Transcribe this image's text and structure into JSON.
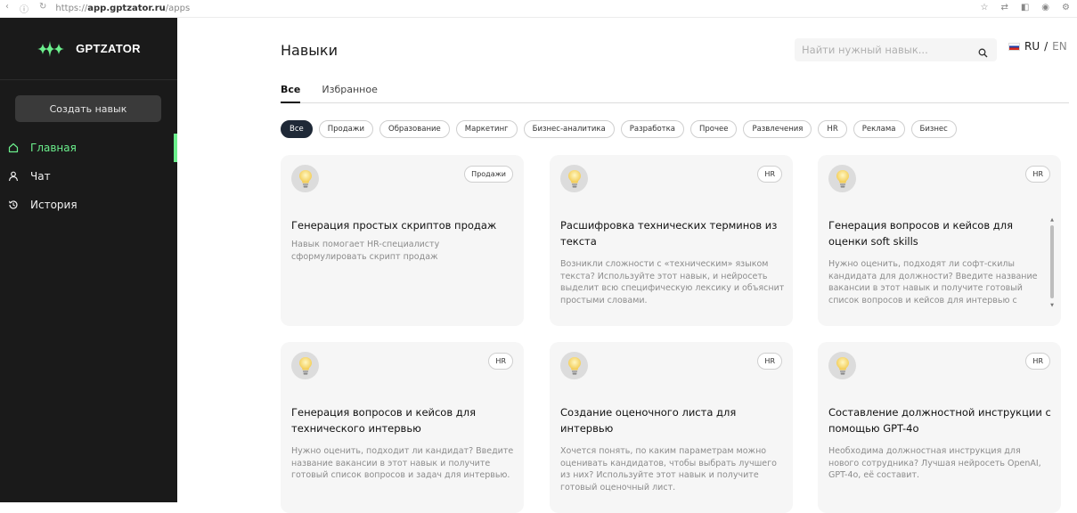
{
  "browser": {
    "url_prefix": "https://",
    "url_domain": "app.gptzator.ru",
    "url_path": "/apps"
  },
  "sidebar": {
    "logo_text": "GPTZATOR",
    "create_button": "Создать навык",
    "items": [
      {
        "label": "Главная",
        "icon": "home-icon",
        "active": true
      },
      {
        "label": "Чат",
        "icon": "user-icon",
        "active": false
      },
      {
        "label": "История",
        "icon": "history-icon",
        "active": false
      }
    ]
  },
  "header": {
    "title": "Навыки",
    "search_placeholder": "Найти нужный навык...",
    "lang_ru": "RU",
    "lang_sep": "/",
    "lang_en": "EN"
  },
  "tabs": [
    {
      "label": "Все",
      "active": true
    },
    {
      "label": "Избранное",
      "active": false
    }
  ],
  "filters": [
    {
      "label": "Все",
      "active": true
    },
    {
      "label": "Продажи"
    },
    {
      "label": "Образование"
    },
    {
      "label": "Маркетинг"
    },
    {
      "label": "Бизнес-аналитика"
    },
    {
      "label": "Разработка"
    },
    {
      "label": "Прочее"
    },
    {
      "label": "Развлечения"
    },
    {
      "label": "HR"
    },
    {
      "label": "Реклама"
    },
    {
      "label": "Бизнес"
    }
  ],
  "cards": [
    {
      "tag": "Продажи",
      "title": "Генерация простых скриптов продаж",
      "description": "Навык помогает HR-специалисту сформулировать скрипт продаж"
    },
    {
      "tag": "HR",
      "title": "Расшифровка технических терминов из текста",
      "description": "Возникли сложности с «техническим» языком текста? Используйте этот навык, и нейросеть выделит всю специфическую лексику и объяснит простыми словами."
    },
    {
      "tag": "HR",
      "title": "Генерация вопросов и кейсов для оценки soft skills",
      "description": "Нужно оценить, подходят ли софт-скилы кандидата для должности? Введите название вакансии в этот навык и получите готовый список вопросов и кейсов для интервью с"
    },
    {
      "tag": "HR",
      "title": "Генерация вопросов и кейсов для технического интервью",
      "description": "Нужно оценить, подходит ли кандидат? Введите название вакансии в этот навык и получите готовый список вопросов и задач для интервью."
    },
    {
      "tag": "HR",
      "title": "Создание оценочного листа для интервью",
      "description": "Хочется понять, по каким параметрам можно оценивать кандидатов, чтобы выбрать лучшего из них? Используйте этот навык и получите готовый оценочный лист."
    },
    {
      "tag": "HR",
      "title": "Составление должностной инструкции с помощью GPT-4o",
      "description": "Необходима должностная инструкция для нового сотрудника? Лучшая нейросеть OpenAI, GPT-4o, её составит."
    }
  ],
  "colors": {
    "sidebar_bg": "#1a1a1a",
    "accent_green": "#6bef8c",
    "card_bg": "#f6f6f6",
    "chip_active_bg": "#1f2937"
  }
}
